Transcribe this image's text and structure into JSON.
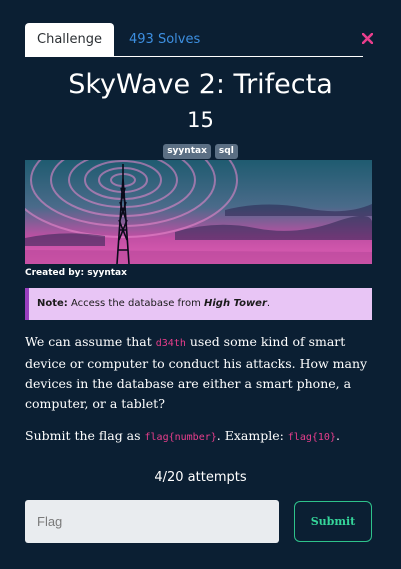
{
  "tabs": [
    {
      "label": "Challenge"
    },
    {
      "label": "493 Solves"
    }
  ],
  "challenge": {
    "title": "SkyWave 2: Trifecta",
    "points": "15",
    "tags": [
      "syyntax",
      "sql"
    ],
    "created_label": "Created by: syyntax",
    "note_label": "Note:",
    "note_text": " Access the database from ",
    "note_place": "High Tower",
    "note_end": ".",
    "desc_part1": "We can assume that ",
    "desc_code": "d34th",
    "desc_part2": " used some kind of smart device or computer to conduct his attacks. How many devices in the database are either a smart phone, a computer, or a tablet?",
    "flag_part1": "Submit the flag as ",
    "flag_code1": "flag{number}",
    "flag_part2": ". Example: ",
    "flag_code2": "flag{10}",
    "flag_part3": "."
  },
  "attempts": "4/20 attempts",
  "form": {
    "placeholder": "Flag",
    "submit_label": "Submit"
  },
  "colors": {
    "background": "#0b1f33",
    "tab_link": "#3d8fe0",
    "code": "#e83e8c",
    "note_bg": "#e8c5f5",
    "submit": "#35d59a",
    "close": "#e83e8c"
  },
  "icons": {
    "close": "close-icon",
    "banner": "radio-tower-image"
  }
}
